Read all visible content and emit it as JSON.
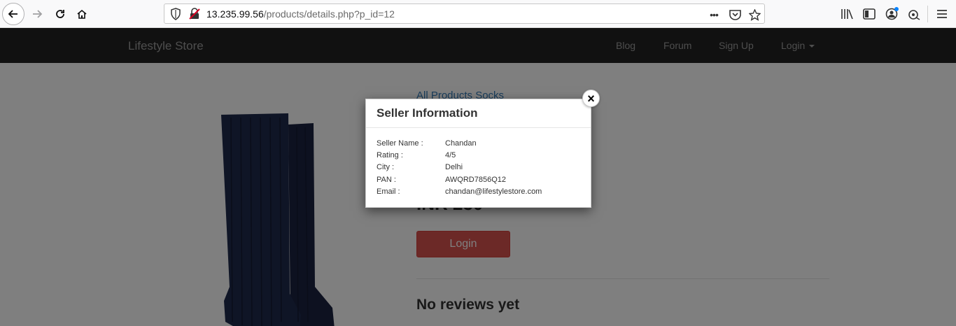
{
  "browser": {
    "url_host": "13.235.99.56",
    "url_path": "/products/details.php?p_id=12",
    "more_label": "•••"
  },
  "navbar": {
    "brand": "Lifestyle Store",
    "links": [
      {
        "label": "Blog"
      },
      {
        "label": "Forum"
      },
      {
        "label": "Sign Up"
      },
      {
        "label": "Login"
      }
    ]
  },
  "product": {
    "breadcrumb": "All Products Socks",
    "price": "INR 250",
    "login_button": "Login",
    "reviews_heading": "No reviews yet"
  },
  "modal": {
    "title": "Seller Information",
    "close_label": "×",
    "rows": [
      {
        "key": "Seller Name :",
        "value": "Chandan"
      },
      {
        "key": "Rating :",
        "value": "4/5"
      },
      {
        "key": "City :",
        "value": "Delhi"
      },
      {
        "key": "PAN :",
        "value": "AWQRD7856Q12"
      },
      {
        "key": "Email :",
        "value": "chandan@lifestylestore.com"
      }
    ]
  },
  "colors": {
    "navbar_bg": "#222222",
    "link_blue": "#337ab7",
    "login_red": "#d9534f"
  }
}
